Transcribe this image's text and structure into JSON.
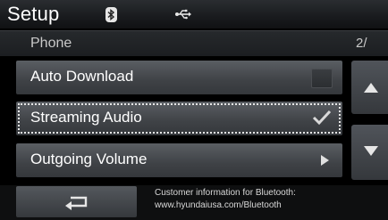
{
  "header": {
    "title": "Setup",
    "icons": [
      "bluetooth-icon",
      "usb-icon"
    ]
  },
  "category": {
    "label": "Phone",
    "page": "2/"
  },
  "list": {
    "items": [
      {
        "label": "Auto Download",
        "control": "checkbox",
        "checked": false
      },
      {
        "label": "Streaming Audio",
        "control": "checkbox",
        "checked": true,
        "focused": true
      },
      {
        "label": "Outgoing Volume",
        "control": "arrow"
      }
    ]
  },
  "scroll": {
    "up": "scroll-up",
    "down": "scroll-down"
  },
  "footer": {
    "back_icon": "back-arrow-icon",
    "info_line1": "Customer information for Bluetooth:",
    "info_line2": "www.hyundaiusa.com/Bluetooth"
  },
  "colors": {
    "background": "#000000",
    "row": "#4a4e53",
    "text": "#ffffff",
    "muted": "#c9c9c9"
  }
}
